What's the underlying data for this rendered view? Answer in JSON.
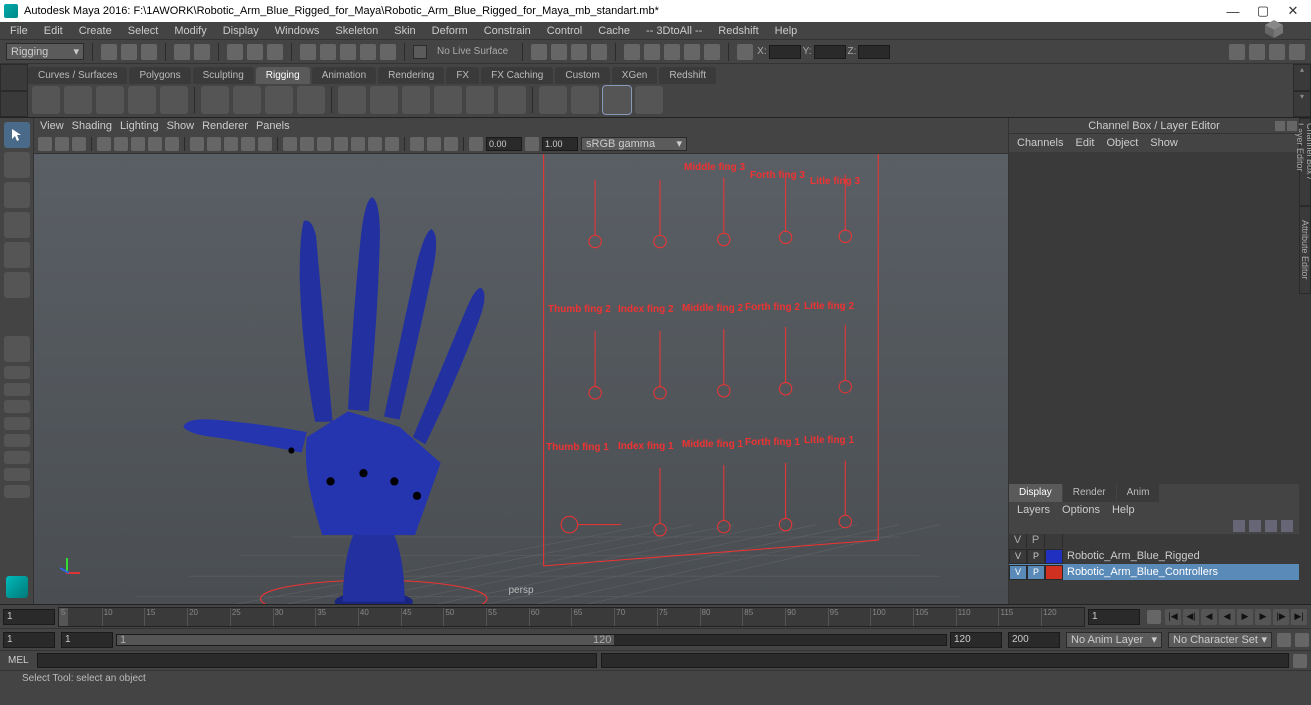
{
  "title": "Autodesk Maya 2016: F:\\1AWORK\\Robotic_Arm_Blue_Rigged_for_Maya\\Robotic_Arm_Blue_Rigged_for_Maya_mb_standart.mb*",
  "menubar": [
    "File",
    "Edit",
    "Create",
    "Select",
    "Modify",
    "Display",
    "Windows",
    "Skeleton",
    "Skin",
    "Deform",
    "Constrain",
    "Control",
    "Cache",
    "-- 3DtoAll --",
    "Redshift",
    "Help"
  ],
  "workspace_dd": "Rigging",
  "status": {
    "nolive": "No Live Surface",
    "x": "X:",
    "y": "Y:",
    "z": "Z:"
  },
  "shelftabs": [
    "Curves / Surfaces",
    "Polygons",
    "Sculpting",
    "Rigging",
    "Animation",
    "Rendering",
    "FX",
    "FX Caching",
    "Custom",
    "XGen",
    "Redshift"
  ],
  "shelf_active_idx": 3,
  "vp_menu": [
    "View",
    "Shading",
    "Lighting",
    "Show",
    "Renderer",
    "Panels"
  ],
  "vp_fields": {
    "f1": "0.00",
    "f2": "1.00"
  },
  "vp_colorspace": "sRGB gamma",
  "vp_camera": "persp",
  "controllers": {
    "row3": [
      "",
      "",
      "Middle fing 3",
      "Forth fing 3",
      "Litle fing 3"
    ],
    "row2": [
      "Thumb fing 2",
      "Index fing 2",
      "Middle fing 2",
      "Forth fing 2",
      "Litle fing 2"
    ],
    "row1": [
      "Thumb fing 1",
      "Index fing 1",
      "Middle fing 1",
      "Forth fing 1",
      "Litle fing 1"
    ]
  },
  "channelbox": {
    "header": "Channel Box / Layer Editor",
    "menu": [
      "Channels",
      "Edit",
      "Object",
      "Show"
    ]
  },
  "side_tabs": [
    "Channel Box / Layer Editor",
    "Attribute Editor"
  ],
  "layers": {
    "tabs": [
      "Display",
      "Render",
      "Anim"
    ],
    "menu": [
      "Layers",
      "Options",
      "Help"
    ],
    "cols": [
      "V",
      "P"
    ],
    "items": [
      {
        "v": "V",
        "p": "P",
        "color": "#2030c0",
        "name": "Robotic_Arm_Blue_Rigged",
        "sel": false
      },
      {
        "v": "V",
        "p": "P",
        "color": "#d03020",
        "name": "Robotic_Arm_Blue_Controllers",
        "sel": true
      }
    ]
  },
  "timeline": {
    "start_frame": "1",
    "current": "1",
    "ticks": [
      "5",
      "10",
      "15",
      "20",
      "25",
      "30",
      "35",
      "40",
      "45",
      "50",
      "55",
      "60",
      "65",
      "70",
      "75",
      "80",
      "85",
      "90",
      "95",
      "100",
      "105",
      "110",
      "115",
      "120"
    ]
  },
  "range": {
    "start": "1",
    "range_start": "1",
    "range_label_start": "1",
    "range_label_end": "120",
    "range_end": "120",
    "end": "200",
    "anim_layer": "No Anim Layer",
    "char_set": "No Character Set"
  },
  "cmd_label": "MEL",
  "helpline": "Select Tool: select an object"
}
